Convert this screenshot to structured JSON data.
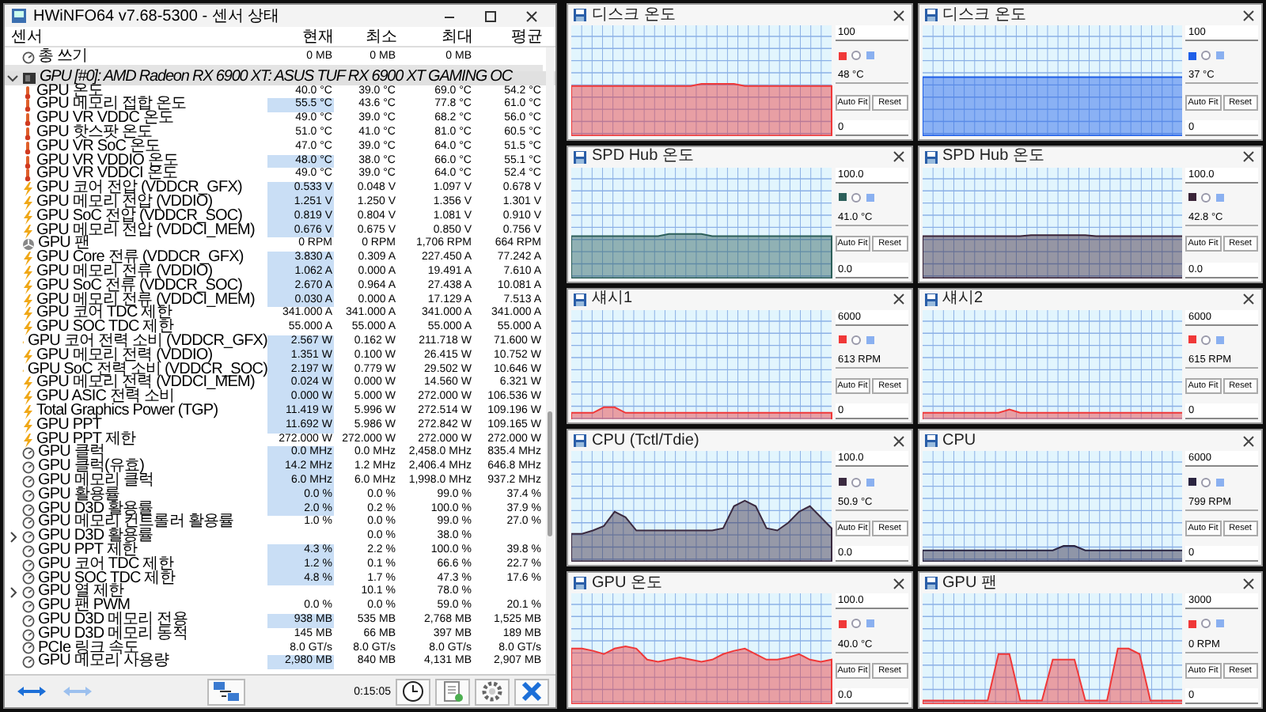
{
  "sensor_window": {
    "title": "HWiNFO64 v7.68-5300 - 센서 상태",
    "columns": [
      "센서",
      "현재",
      "최소",
      "최대",
      "평균"
    ],
    "rows": [
      {
        "kind": "gauge",
        "label": "총 쓰기",
        "current": "0 MB",
        "min": "0 MB",
        "max": "0 MB",
        "highlighted": false
      },
      {
        "kind": "blank"
      },
      {
        "kind": "device",
        "label": "GPU [#0]: AMD Radeon RX 6900 XT: ASUS TUF RX 6900 XT GAMING OC",
        "expanded": true
      },
      {
        "kind": "temp",
        "label": "GPU 온도",
        "current": "40.0 °C",
        "min": "39.0 °C",
        "max": "69.0 °C",
        "avg": "54.2 °C",
        "highlighted": false
      },
      {
        "kind": "temp",
        "label": "GPU 메모리 접합 온도",
        "current": "55.5 °C",
        "min": "43.6 °C",
        "max": "77.8 °C",
        "avg": "61.0 °C",
        "highlighted": true
      },
      {
        "kind": "temp",
        "label": "GPU VR VDDC 온도",
        "current": "49.0 °C",
        "min": "39.0 °C",
        "max": "68.2 °C",
        "avg": "56.0 °C",
        "highlighted": false
      },
      {
        "kind": "temp",
        "label": "GPU 핫스팟 온도",
        "current": "51.0 °C",
        "min": "41.0 °C",
        "max": "81.0 °C",
        "avg": "60.5 °C",
        "highlighted": false
      },
      {
        "kind": "temp",
        "label": "GPU VR SoC 온도",
        "current": "47.0 °C",
        "min": "39.0 °C",
        "max": "64.0 °C",
        "avg": "51.5 °C",
        "highlighted": false
      },
      {
        "kind": "temp",
        "label": "GPU VR VDDIO 온도",
        "current": "48.0 °C",
        "min": "38.0 °C",
        "max": "66.0 °C",
        "avg": "55.1 °C",
        "highlighted": true
      },
      {
        "kind": "temp",
        "label": "GPU VR VDDCI 온도",
        "current": "49.0 °C",
        "min": "39.0 °C",
        "max": "64.0 °C",
        "avg": "52.4 °C",
        "highlighted": false
      },
      {
        "kind": "electric",
        "label": "GPU 코어 전압 (VDDCR_GFX)",
        "current": "0.533 V",
        "min": "0.048 V",
        "max": "1.097 V",
        "avg": "0.678 V",
        "highlighted": true
      },
      {
        "kind": "electric",
        "label": "GPU 메모리 전압 (VDDIO)",
        "current": "1.251 V",
        "min": "1.250 V",
        "max": "1.356 V",
        "avg": "1.301 V",
        "highlighted": true
      },
      {
        "kind": "electric",
        "label": "GPU SoC 전압 (VDDCR_SOC)",
        "current": "0.819 V",
        "min": "0.804 V",
        "max": "1.081 V",
        "avg": "0.910 V",
        "highlighted": true
      },
      {
        "kind": "electric",
        "label": "GPU 메모리 전압 (VDDCI_MEM)",
        "current": "0.676 V",
        "min": "0.675 V",
        "max": "0.850 V",
        "avg": "0.756 V",
        "highlighted": true
      },
      {
        "kind": "fan",
        "label": "GPU 팬",
        "current": "0 RPM",
        "min": "0 RPM",
        "max": "1,706 RPM",
        "avg": "664 RPM",
        "highlighted": false
      },
      {
        "kind": "electric",
        "label": "GPU Core 전류 (VDDCR_GFX)",
        "current": "3.830 A",
        "min": "0.309 A",
        "max": "227.450 A",
        "avg": "77.242 A",
        "highlighted": true
      },
      {
        "kind": "electric",
        "label": "GPU 메모리 전류 (VDDIO)",
        "current": "1.062 A",
        "min": "0.000 A",
        "max": "19.491 A",
        "avg": "7.610 A",
        "highlighted": true
      },
      {
        "kind": "electric",
        "label": "GPU SoC 전류 (VDDCR_SOC)",
        "current": "2.670 A",
        "min": "0.964 A",
        "max": "27.438 A",
        "avg": "10.081 A",
        "highlighted": true
      },
      {
        "kind": "electric",
        "label": "GPU 메모리 전류 (VDDCI_MEM)",
        "current": "0.030 A",
        "min": "0.000 A",
        "max": "17.129 A",
        "avg": "7.513 A",
        "highlighted": true
      },
      {
        "kind": "electric",
        "label": "GPU 코어 TDC 제한",
        "current": "341.000 A",
        "min": "341.000 A",
        "max": "341.000 A",
        "avg": "341.000 A",
        "highlighted": false
      },
      {
        "kind": "electric",
        "label": "GPU SOC TDC 제한",
        "current": "55.000 A",
        "min": "55.000 A",
        "max": "55.000 A",
        "avg": "55.000 A",
        "highlighted": false
      },
      {
        "kind": "electric",
        "label": "GPU 코어 전력 소비 (VDDCR_GFX)",
        "current": "2.567 W",
        "min": "0.162 W",
        "max": "211.718 W",
        "avg": "71.600 W",
        "highlighted": true
      },
      {
        "kind": "electric",
        "label": "GPU 메모리 전력 (VDDIO)",
        "current": "1.351 W",
        "min": "0.100 W",
        "max": "26.415 W",
        "avg": "10.752 W",
        "highlighted": true
      },
      {
        "kind": "electric",
        "label": "GPU SoC 전력 소비 (VDDCR_SOC)",
        "current": "2.197 W",
        "min": "0.779 W",
        "max": "29.502 W",
        "avg": "10.646 W",
        "highlighted": true
      },
      {
        "kind": "electric",
        "label": "GPU 메모리 전력 (VDDCI_MEM)",
        "current": "0.024 W",
        "min": "0.000 W",
        "max": "14.560 W",
        "avg": "6.321 W",
        "highlighted": true
      },
      {
        "kind": "electric",
        "label": "GPU ASIC 전력 소비",
        "current": "0.000 W",
        "min": "5.000 W",
        "max": "272.000 W",
        "avg": "106.536 W",
        "highlighted": true
      },
      {
        "kind": "electric",
        "label": "Total Graphics Power (TGP)",
        "current": "11.419 W",
        "min": "5.996 W",
        "max": "272.514 W",
        "avg": "109.196 W",
        "highlighted": true
      },
      {
        "kind": "electric",
        "label": "GPU PPT",
        "current": "11.692 W",
        "min": "5.986 W",
        "max": "272.842 W",
        "avg": "109.165 W",
        "highlighted": true
      },
      {
        "kind": "electric",
        "label": "GPU PPT 제한",
        "current": "272.000 W",
        "min": "272.000 W",
        "max": "272.000 W",
        "avg": "272.000 W",
        "highlighted": false
      },
      {
        "kind": "gauge",
        "label": "GPU 클럭",
        "current": "0.0 MHz",
        "min": "0.0 MHz",
        "max": "2,458.0 MHz",
        "avg": "835.4 MHz",
        "highlighted": true
      },
      {
        "kind": "gauge",
        "label": "GPU 클럭(유효)",
        "current": "14.2 MHz",
        "min": "1.2 MHz",
        "max": "2,406.4 MHz",
        "avg": "646.8 MHz",
        "highlighted": true
      },
      {
        "kind": "gauge",
        "label": "GPU 메모리 클럭",
        "current": "6.0 MHz",
        "min": "6.0 MHz",
        "max": "1,998.0 MHz",
        "avg": "937.2 MHz",
        "highlighted": true
      },
      {
        "kind": "gauge",
        "label": "GPU 활용률",
        "current": "0.0 %",
        "min": "0.0 %",
        "max": "99.0 %",
        "avg": "37.4 %",
        "highlighted": true
      },
      {
        "kind": "gauge",
        "label": "GPU D3D 활용률",
        "current": "2.0 %",
        "min": "0.2 %",
        "max": "100.0 %",
        "avg": "37.9 %",
        "highlighted": true
      },
      {
        "kind": "gauge",
        "label": "GPU 메모리 컨트롤러 활용률",
        "current": "1.0 %",
        "min": "0.0 %",
        "max": "99.0 %",
        "avg": "27.0 %",
        "highlighted": false
      },
      {
        "kind": "group",
        "label": "GPU D3D 활용률",
        "min": "0.0 %",
        "max": "38.0 %",
        "expanded": false
      },
      {
        "kind": "gauge",
        "label": "GPU PPT 제한",
        "current": "4.3 %",
        "min": "2.2 %",
        "max": "100.0 %",
        "avg": "39.8 %",
        "highlighted": true
      },
      {
        "kind": "gauge",
        "label": "GPU 코어 TDC 제한",
        "current": "1.2 %",
        "min": "0.1 %",
        "max": "66.6 %",
        "avg": "22.7 %",
        "highlighted": true
      },
      {
        "kind": "gauge",
        "label": "GPU SOC TDC 제한",
        "current": "4.8 %",
        "min": "1.7 %",
        "max": "47.3 %",
        "avg": "17.6 %",
        "highlighted": true
      },
      {
        "kind": "group",
        "label": "GPU 열 제한",
        "min": "10.1 %",
        "max": "78.0 %",
        "expanded": false
      },
      {
        "kind": "gauge",
        "label": "GPU 팬 PWM",
        "current": "0.0 %",
        "min": "0.0 %",
        "max": "59.0 %",
        "avg": "20.1 %",
        "highlighted": false
      },
      {
        "kind": "gauge",
        "label": "GPU D3D 메모리 전용",
        "current": "938 MB",
        "min": "535 MB",
        "max": "2,768 MB",
        "avg": "1,525 MB",
        "highlighted": true
      },
      {
        "kind": "gauge",
        "label": "GPU D3D 메모리 동적",
        "current": "145 MB",
        "min": "66 MB",
        "max": "397 MB",
        "avg": "189 MB",
        "highlighted": false
      },
      {
        "kind": "gauge",
        "label": "PCIe 링크 속도",
        "current": "8.0 GT/s",
        "min": "8.0 GT/s",
        "max": "8.0 GT/s",
        "avg": "8.0 GT/s",
        "highlighted": false
      },
      {
        "kind": "gauge",
        "label": "GPU 메모리 사용량",
        "current": "2,980 MB",
        "min": "840 MB",
        "max": "4,131 MB",
        "avg": "2,907 MB",
        "highlighted": true
      }
    ],
    "timer": "0:15:05"
  },
  "graph_windows": [
    {
      "title": "디스크 온도",
      "max": "100",
      "current": "48 °C",
      "min": "0",
      "color": "#f03838",
      "auto_fit": "Auto Fit",
      "reset": "Reset"
    },
    {
      "title": "디스크 온도",
      "max": "100",
      "current": "37 °C",
      "min": "0",
      "color": "#1f5fe8",
      "auto_fit": "Auto Fit",
      "reset": "Reset"
    },
    {
      "title": "SPD Hub 온도",
      "max": "100.0",
      "current": "41.0 °C",
      "min": "0.0",
      "color": "#2c5f5a",
      "auto_fit": "Auto Fit",
      "reset": "Reset"
    },
    {
      "title": "SPD Hub 온도",
      "max": "100.0",
      "current": "42.8 °C",
      "min": "0.0",
      "color": "#3a2438",
      "auto_fit": "Auto Fit",
      "reset": "Reset"
    },
    {
      "title": "섀시1",
      "max": "6000",
      "current": "613 RPM",
      "min": "0",
      "color": "#f03838",
      "auto_fit": "Auto Fit",
      "reset": "Reset"
    },
    {
      "title": "섀시2",
      "max": "6000",
      "current": "615 RPM",
      "min": "0",
      "color": "#f03838",
      "auto_fit": "Auto Fit",
      "reset": "Reset"
    },
    {
      "title": "CPU (Tctl/Tdie)",
      "max": "100.0",
      "current": "50.9 °C",
      "min": "0.0",
      "color": "#3a2a40",
      "auto_fit": "Auto Fit",
      "reset": "Reset"
    },
    {
      "title": "CPU",
      "max": "6000",
      "current": "799 RPM",
      "min": "0",
      "color": "#2a2440",
      "auto_fit": "Auto Fit",
      "reset": "Reset"
    },
    {
      "title": "GPU 온도",
      "max": "100.0",
      "current": "40.0 °C",
      "min": "0.0",
      "color": "#f03838",
      "auto_fit": "Auto Fit",
      "reset": "Reset"
    },
    {
      "title": "GPU 팬",
      "max": "3000",
      "current": "0 RPM",
      "min": "0",
      "color": "#f03838",
      "auto_fit": "Auto Fit",
      "reset": "Reset"
    }
  ]
}
